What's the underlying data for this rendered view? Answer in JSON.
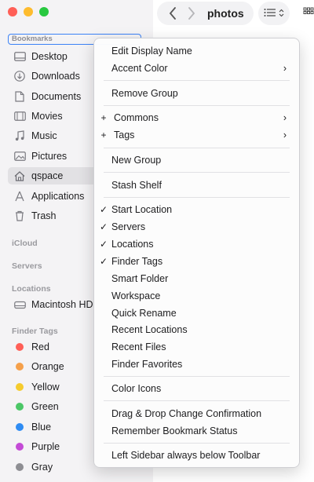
{
  "toolbar": {
    "title": "photos",
    "back_glyph": "‹",
    "forward_glyph": "›"
  },
  "sidebar": {
    "bookmarks_title": "Bookmarks",
    "bookmarks": [
      {
        "label": "Desktop",
        "icon": "desktop-icon"
      },
      {
        "label": "Downloads",
        "icon": "downloads-icon"
      },
      {
        "label": "Documents",
        "icon": "document-icon"
      },
      {
        "label": "Movies",
        "icon": "film-icon"
      },
      {
        "label": "Music",
        "icon": "music-note-icon"
      },
      {
        "label": "Pictures",
        "icon": "picture-icon"
      },
      {
        "label": "qspace",
        "icon": "home-icon",
        "selected": true
      },
      {
        "label": "Applications",
        "icon": "applications-icon"
      },
      {
        "label": "Trash",
        "icon": "trash-icon"
      }
    ],
    "icloud_title": "iCloud",
    "servers_title": "Servers",
    "locations_title": "Locations",
    "locations": [
      {
        "label": "Macintosh HD",
        "icon": "disk-icon"
      }
    ],
    "finder_tags_title": "Finder Tags",
    "tags": [
      {
        "label": "Red",
        "color": "#ff5f57"
      },
      {
        "label": "Orange",
        "color": "#f5a04b"
      },
      {
        "label": "Yellow",
        "color": "#f5cb2e"
      },
      {
        "label": "Green",
        "color": "#4cc767"
      },
      {
        "label": "Blue",
        "color": "#2f8cf3"
      },
      {
        "label": "Purple",
        "color": "#c44bd6"
      },
      {
        "label": "Gray",
        "color": "#8e8e93"
      }
    ]
  },
  "menu": {
    "edit_display_name": "Edit Display Name",
    "accent_color": "Accent Color",
    "remove_group": "Remove Group",
    "commons": "Commons",
    "tags": "Tags",
    "new_group": "New Group",
    "stash_shelf": "Stash Shelf",
    "start_location": "Start Location",
    "servers": "Servers",
    "locations": "Locations",
    "finder_tags": "Finder Tags",
    "smart_folder": "Smart Folder",
    "workspace": "Workspace",
    "quick_rename": "Quick Rename",
    "recent_locations": "Recent Locations",
    "recent_files": "Recent Files",
    "finder_favorites": "Finder Favorites",
    "color_icons": "Color Icons",
    "drag_drop": "Drag & Drop Change Confirmation",
    "remember_bookmark": "Remember Bookmark Status",
    "left_sidebar": "Left Sidebar always below Toolbar",
    "check_glyph": "✓",
    "plus_glyph": "+",
    "chevron_glyph": "›"
  }
}
